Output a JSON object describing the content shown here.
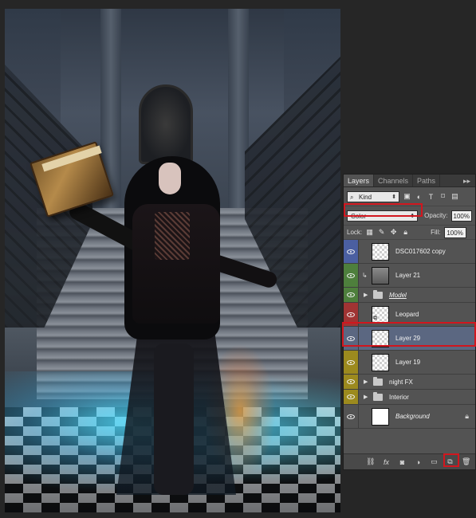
{
  "panel": {
    "tabs": [
      {
        "label": "Layers",
        "active": true
      },
      {
        "label": "Channels",
        "active": false
      },
      {
        "label": "Paths",
        "active": false
      }
    ],
    "menu_glyph": "▸▸",
    "filter": {
      "label": "Kind",
      "icon": "search-icon"
    },
    "filter_icons": [
      "image-filter-icon",
      "adjustment-filter-icon",
      "type-filter-icon",
      "shape-filter-icon",
      "smart-object-filter-icon"
    ],
    "blend_mode": "Color",
    "opacity_label": "Opacity:",
    "opacity_value": "100%",
    "lock_label": "Lock:",
    "lock_icons": [
      "lock-transparent-icon",
      "lock-image-icon",
      "lock-position-icon",
      "lock-all-icon"
    ],
    "fill_label": "Fill:",
    "fill_value": "100%",
    "highlight_color": "#d1161e",
    "selected_color": "#5b6781"
  },
  "layers": [
    {
      "name": "DSC017602 copy",
      "color_tag": "blue",
      "type": "pixel",
      "clipped": false
    },
    {
      "name": "Layer 21",
      "color_tag": "green",
      "type": "pixel-dark",
      "clipped": true
    },
    {
      "name": "Model",
      "color_tag": "green",
      "type": "group",
      "clipped": false
    },
    {
      "name": "Leopard",
      "color_tag": "red",
      "type": "pixel",
      "clipped": false
    },
    {
      "name": "Layer 29",
      "color_tag": "none",
      "type": "pixel",
      "clipped": false,
      "selected": true
    },
    {
      "name": "Layer 19",
      "color_tag": "yellow",
      "type": "pixel",
      "clipped": false
    },
    {
      "name": "night FX",
      "color_tag": "yellow",
      "type": "group",
      "clipped": false
    },
    {
      "name": "Interior",
      "color_tag": "yellow",
      "type": "group",
      "clipped": false
    },
    {
      "name": "Background",
      "color_tag": "none",
      "type": "background",
      "clipped": false,
      "locked": true
    }
  ],
  "bottom_bar": [
    "link-layers-icon",
    "fx-icon",
    "add-mask-icon",
    "adjustment-layer-icon",
    "new-group-icon",
    "new-layer-icon",
    "delete-layer-icon"
  ],
  "bottom_labels": {
    "fx": "fx"
  }
}
